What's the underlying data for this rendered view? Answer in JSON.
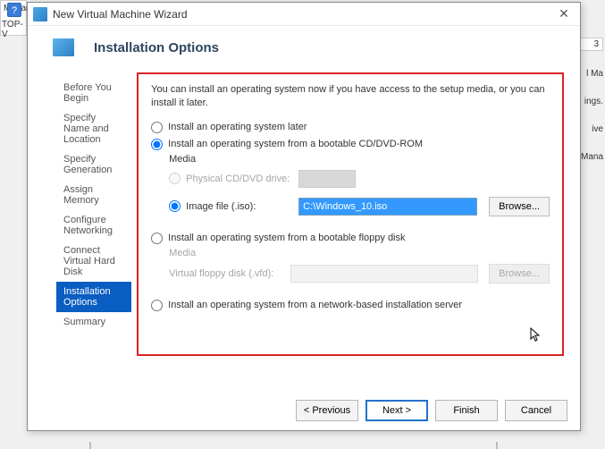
{
  "bg": {
    "manage": "Manag",
    "top": "TOP-V",
    "rightBits": [
      "l Ma",
      "ings.",
      "ive",
      "Mana"
    ],
    "tab3": "3"
  },
  "window": {
    "title": "New Virtual Machine Wizard",
    "close": "✕",
    "headerTitle": "Installation Options"
  },
  "steps": {
    "s0": "Before You Begin",
    "s1": "Specify Name and Location",
    "s2": "Specify Generation",
    "s3": "Assign Memory",
    "s4": "Configure Networking",
    "s5": "Connect Virtual Hard Disk",
    "s6": "Installation Options",
    "s7": "Summary"
  },
  "content": {
    "intro": "You can install an operating system now if you have access to the setup media, or you can install it later.",
    "optLater": "Install an operating system later",
    "optCd": "Install an operating system from a bootable CD/DVD-ROM",
    "mediaHeading": "Media",
    "physDrive": "Physical CD/DVD drive:",
    "imageFile": "Image file (.iso):",
    "isoValue": "C:\\Windows_10.iso",
    "browse": "Browse...",
    "optFloppy": "Install an operating system from a bootable floppy disk",
    "floppyLabel": "Virtual floppy disk (.vfd):",
    "optNetwork": "Install an operating system from a network-based installation server"
  },
  "buttons": {
    "prev": "< Previous",
    "next": "Next >",
    "finish": "Finish",
    "cancel": "Cancel"
  }
}
